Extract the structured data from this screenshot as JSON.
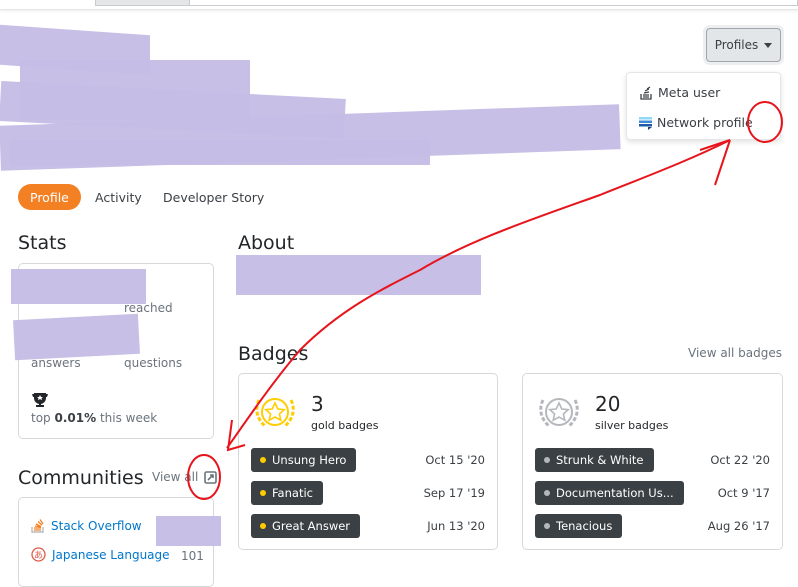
{
  "header": {
    "profiles_button": "Profiles",
    "dropdown": [
      {
        "label": "Meta user",
        "icon": "stack-exchange-meta-icon"
      },
      {
        "label": "Network profile",
        "icon": "stack-exchange-network-icon"
      }
    ]
  },
  "tabs": [
    {
      "label": "Profile",
      "active": true
    },
    {
      "label": "Activity"
    },
    {
      "label": "Developer Story"
    }
  ],
  "stats": {
    "title": "Stats",
    "reached_label": "reached",
    "answers_label": "answers",
    "questions_label": "questions",
    "rank_prefix": "top",
    "rank_value": "0.01%",
    "rank_suffix": "this week"
  },
  "about": {
    "title": "About"
  },
  "badges": {
    "title": "Badges",
    "view_all": "View all badges",
    "gold": {
      "count": "3",
      "label": "gold badges",
      "color": "#ffcc01",
      "items": [
        {
          "name": "Unsung Hero",
          "date": "Oct 15 '20"
        },
        {
          "name": "Fanatic",
          "date": "Sep 17 '19"
        },
        {
          "name": "Great Answer",
          "date": "Jun 13 '20"
        }
      ]
    },
    "silver": {
      "count": "20",
      "label": "silver badges",
      "color": "#b4b8bc",
      "items": [
        {
          "name": "Strunk & White",
          "date": "Oct 22 '20"
        },
        {
          "name": "Documentation Us...",
          "date": "Oct 9 '17"
        },
        {
          "name": "Tenacious",
          "date": "Aug 26 '17"
        }
      ]
    }
  },
  "communities": {
    "title": "Communities",
    "view_all": "View all",
    "items": [
      {
        "name": "Stack Overflow",
        "rep": ""
      },
      {
        "name": "Japanese Language",
        "rep": "101"
      }
    ]
  },
  "colors": {
    "accent": "#f48024",
    "link": "#0077cc",
    "annotation": "#e8141c",
    "redaction": "#c5bde5"
  }
}
